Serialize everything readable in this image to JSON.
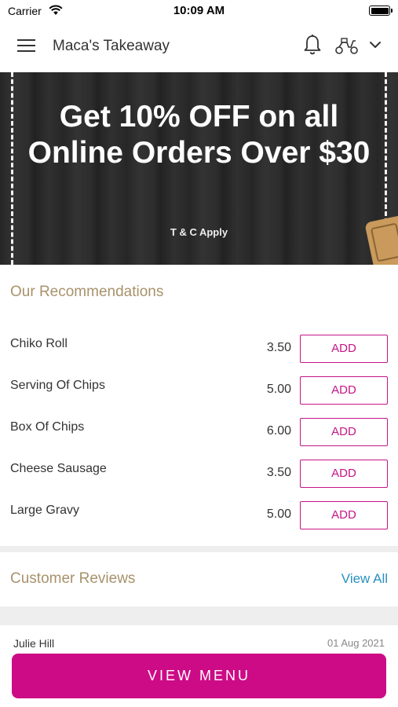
{
  "status_bar": {
    "carrier": "Carrier",
    "time": "10:09 AM"
  },
  "header": {
    "title": "Maca's Takeaway",
    "icons": [
      "menu-icon",
      "bell-icon",
      "scooter-icon",
      "chevron-down-icon"
    ]
  },
  "banner": {
    "headline": "Get 10% OFF on all Online Orders Over $30",
    "terms": "T & C Apply"
  },
  "recommendations": {
    "title": "Our Recommendations",
    "items": [
      {
        "name": "Chiko Roll",
        "price": "3.50",
        "action": "ADD"
      },
      {
        "name": "Serving Of Chips",
        "price": "5.00",
        "action": "ADD"
      },
      {
        "name": "Box Of Chips",
        "price": "6.00",
        "action": "ADD"
      },
      {
        "name": "Cheese Sausage",
        "price": "3.50",
        "action": "ADD"
      },
      {
        "name": "Large Gravy",
        "price": "5.00",
        "action": "ADD"
      }
    ]
  },
  "reviews": {
    "title": "Customer Reviews",
    "view_all": "View All",
    "items": [
      {
        "author": "Julie Hill",
        "date": "01 Aug 2021"
      }
    ]
  },
  "footer": {
    "view_menu_label": "VIEW MENU"
  },
  "colors": {
    "accent": "#cd0b86",
    "section_title": "#a8926b",
    "link": "#2a8fbf"
  }
}
